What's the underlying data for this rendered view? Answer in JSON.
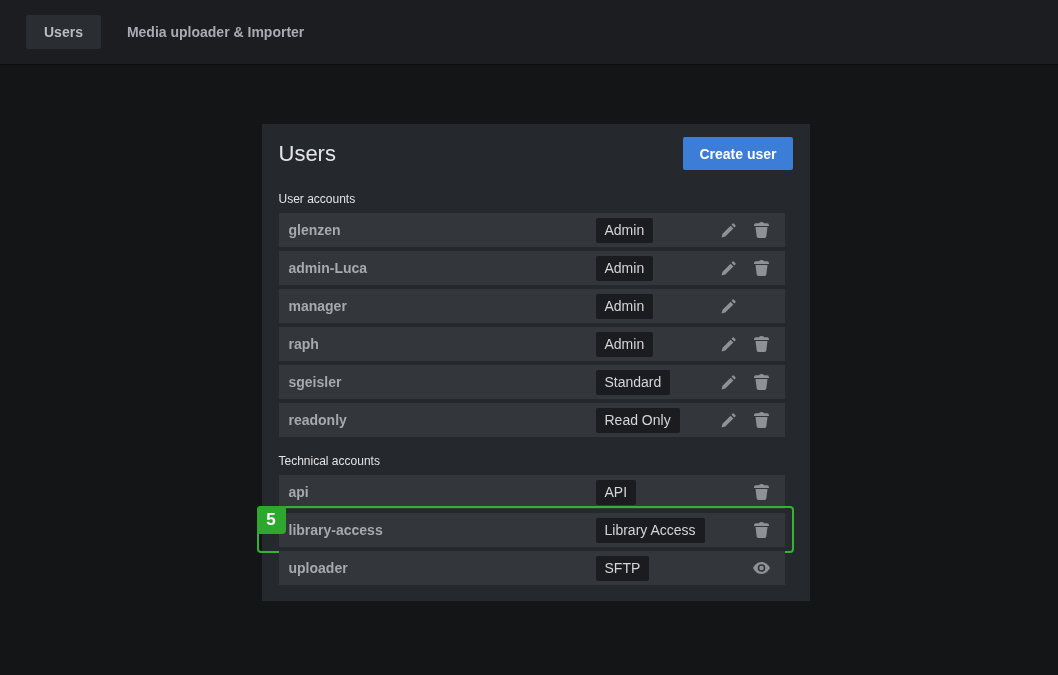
{
  "tabs": [
    {
      "label": "Users",
      "selected": true
    },
    {
      "label": "Media uploader & Importer",
      "selected": false
    }
  ],
  "panel": {
    "title": "Users",
    "create_button": "Create user",
    "sections": [
      {
        "heading": "User accounts",
        "rows": [
          {
            "name": "glenzen",
            "role": "Admin",
            "actions": [
              {
                "kind": "edit"
              },
              {
                "kind": "delete"
              }
            ]
          },
          {
            "name": "admin-Luca",
            "role": "Admin",
            "actions": [
              {
                "kind": "edit"
              },
              {
                "kind": "delete"
              }
            ]
          },
          {
            "name": "manager",
            "role": "Admin",
            "actions": [
              {
                "kind": "edit"
              }
            ]
          },
          {
            "name": "raph",
            "role": "Admin",
            "actions": [
              {
                "kind": "edit"
              },
              {
                "kind": "delete"
              }
            ]
          },
          {
            "name": "sgeisler",
            "role": "Standard",
            "actions": [
              {
                "kind": "edit"
              },
              {
                "kind": "delete"
              }
            ]
          },
          {
            "name": "readonly",
            "role": "Read Only",
            "actions": [
              {
                "kind": "edit"
              },
              {
                "kind": "delete"
              }
            ]
          }
        ]
      },
      {
        "heading": "Technical accounts",
        "rows": [
          {
            "name": "api",
            "role": "API",
            "actions": [
              {
                "kind": "delete"
              }
            ]
          },
          {
            "name": "library-access",
            "role": "Library Access",
            "actions": [
              {
                "kind": "delete"
              }
            ],
            "callout": "5"
          },
          {
            "name": "uploader",
            "role": "SFTP",
            "actions": [
              {
                "kind": "view"
              }
            ]
          }
        ]
      }
    ]
  }
}
